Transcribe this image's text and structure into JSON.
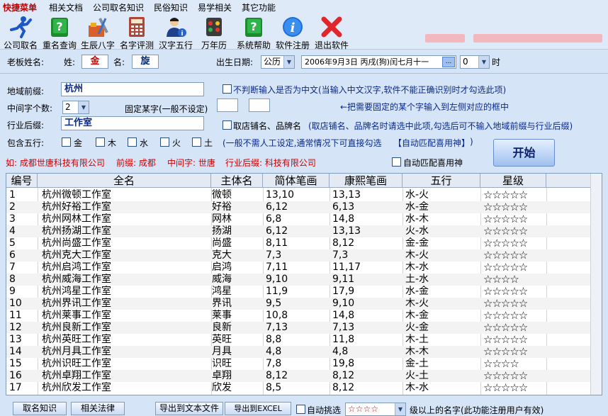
{
  "menu": [
    "快捷菜单",
    "相关文档",
    "公司取名知识",
    "民俗知识",
    "易学相关",
    "其它功能"
  ],
  "toolbar": [
    {
      "label": "公司取名",
      "icon": "running-man-icon"
    },
    {
      "label": "重名查询",
      "icon": "green-book-icon"
    },
    {
      "label": "生辰八字",
      "icon": "tools-icon"
    },
    {
      "label": "名字评测",
      "icon": "calculator-icon"
    },
    {
      "label": "汉字五行",
      "icon": "person-info-icon"
    },
    {
      "label": "万年历",
      "icon": "traffic-light-icon"
    },
    {
      "label": "系统帮助",
      "icon": "help-book-icon"
    },
    {
      "label": "软件注册",
      "icon": "info-icon"
    },
    {
      "label": "退出软件",
      "icon": "red-x-icon"
    }
  ],
  "boss": {
    "label": "老板姓名:",
    "surname_label": "姓:",
    "surname": "金",
    "given_label": "名:",
    "given": "旋",
    "birth_label": "出生日期:",
    "calendar": "公历",
    "date": "2006年9月3日  丙戌(狗)闰七月十一",
    "date_btn": "...",
    "hour": "0",
    "hour_unit": "时"
  },
  "prefix": {
    "label": "地域前缀:",
    "value": "杭州",
    "check_label": "不判断输入是否为中文(当输入中文汉字,软件不能正确识别时才勾选此项)"
  },
  "middle": {
    "label": "中间字个数:",
    "value": "2",
    "fixed_label": "固定某字(一般不设定)",
    "hint": "←把需要固定的某个字输入到左侧对应的框中"
  },
  "suffix": {
    "label": "行业后缀:",
    "value": "工作室",
    "check_label": "取店铺名、品牌名",
    "check_hint": "(取店铺名、品牌名时请选中此项,勾选后可不输入地域前缀与行业后缀)"
  },
  "wuxing": {
    "label": "包含五行:",
    "items": [
      "金",
      "木",
      "水",
      "火",
      "土"
    ],
    "hint": "(一般不需人工设定,通常情况下可直接勾选",
    "auto_btn": "【自动匹配喜用神】",
    "close_paren": ")"
  },
  "example": {
    "text": "如: 成都世唐科技有限公司",
    "prefix": "前缀: 成都",
    "middle": "中间字: 世唐",
    "suffix": "行业后缀: 科技有限公司",
    "auto_check": "自动匹配喜用神"
  },
  "start_button": "开始",
  "table": {
    "columns": [
      "编号",
      "全名",
      "主体名",
      "简体笔画",
      "康熙笔画",
      "五行",
      "星级"
    ],
    "rows": [
      [
        "1",
        "杭州微顿工作室",
        "微顿",
        "13,10",
        "13,13",
        "水-火",
        "☆☆☆☆☆"
      ],
      [
        "2",
        "杭州好裕工作室",
        "好裕",
        "6,12",
        "6,13",
        "水-金",
        "☆☆☆☆☆"
      ],
      [
        "3",
        "杭州网林工作室",
        "网林",
        "6,8",
        "14,8",
        "水-木",
        "☆☆☆☆☆"
      ],
      [
        "4",
        "杭州扬湖工作室",
        "扬湖",
        "6,12",
        "13,13",
        "火-水",
        "☆☆☆☆☆"
      ],
      [
        "5",
        "杭州尚盛工作室",
        "尚盛",
        "8,11",
        "8,12",
        "金-金",
        "☆☆☆☆☆"
      ],
      [
        "6",
        "杭州克大工作室",
        "克大",
        "7,3",
        "7,3",
        "木-火",
        "☆☆☆☆☆"
      ],
      [
        "7",
        "杭州启鸿工作室",
        "启鸿",
        "7,11",
        "11,17",
        "木-水",
        "☆☆☆☆☆"
      ],
      [
        "8",
        "杭州威海工作室",
        "威海",
        "9,10",
        "9,11",
        "土-水",
        "☆☆☆☆"
      ],
      [
        "9",
        "杭州鸿星工作室",
        "鸿星",
        "11,9",
        "17,9",
        "水-金",
        "☆☆☆☆☆"
      ],
      [
        "10",
        "杭州界讯工作室",
        "界讯",
        "9,5",
        "9,10",
        "木-火",
        "☆☆☆☆☆"
      ],
      [
        "11",
        "杭州莱事工作室",
        "莱事",
        "10,8",
        "14,8",
        "木-金",
        "☆☆☆☆☆"
      ],
      [
        "12",
        "杭州良新工作室",
        "良新",
        "7,13",
        "7,13",
        "火-金",
        "☆☆☆☆☆"
      ],
      [
        "13",
        "杭州英旺工作室",
        "英旺",
        "8,8",
        "11,8",
        "木-土",
        "☆☆☆☆☆"
      ],
      [
        "14",
        "杭州月具工作室",
        "月具",
        "4,8",
        "4,8",
        "木-木",
        "☆☆☆☆☆"
      ],
      [
        "15",
        "杭州识旺工作室",
        "识旺",
        "7,8",
        "19,8",
        "金-土",
        "☆☆☆☆"
      ],
      [
        "16",
        "杭州卓翔工作室",
        "卓翔",
        "8,12",
        "8,12",
        "火-土",
        "☆☆☆☆☆"
      ],
      [
        "17",
        "杭州欣发工作室",
        "欣发",
        "8,5",
        "8,12",
        "木-水",
        "☆☆☆☆☆"
      ]
    ]
  },
  "bottom": {
    "btn1": "取名知识",
    "btn2": "相关法律",
    "btn3": "导出到文本文件",
    "btn4": "导出到EXCEL",
    "auto_pick": "自动挑选",
    "stars": "☆☆☆☆",
    "hint": "级以上的名字(此功能注册用户有效)"
  }
}
